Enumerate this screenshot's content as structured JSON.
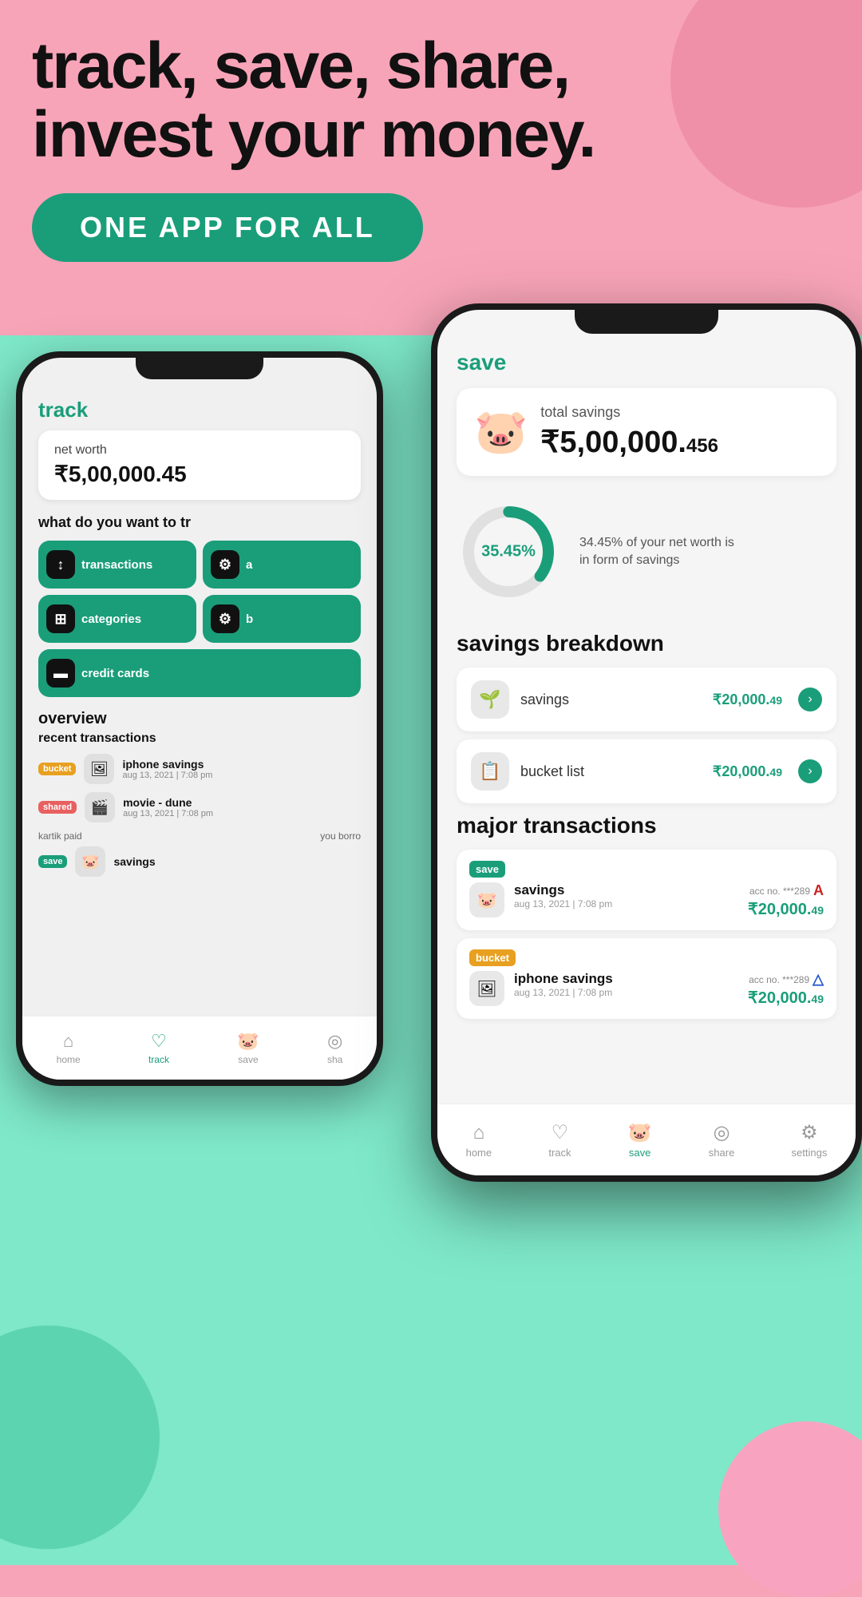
{
  "header": {
    "headline_line1": "track, save, share,",
    "headline_line2": "invest your money.",
    "cta": "ONE APP FOR ALL"
  },
  "track_screen": {
    "tab_label": "track",
    "net_worth_label": "net worth",
    "net_worth_value": "₹5,00,000.45",
    "question": "what do you want to tr",
    "buttons": [
      {
        "icon": "↕",
        "label": "transactions"
      },
      {
        "icon": "⚙",
        "label": "a"
      },
      {
        "icon": "⊞",
        "label": "categories"
      },
      {
        "icon": "⚙",
        "label": "b"
      },
      {
        "icon": "▬",
        "label": "credit cards"
      }
    ],
    "overview_label": "overview",
    "recent_label": "recent transactions",
    "transactions": [
      {
        "badge": "bucket",
        "icon": "🖼",
        "name": "iphone savings",
        "date": "aug 13, 2021 | 7:08 pm"
      },
      {
        "badge": "shared",
        "icon": "🎬",
        "name": "movie - dune",
        "date": "aug 13, 2021 | 7:08 pm"
      },
      {
        "badge": "save",
        "icon": "🐷",
        "name": "savings",
        "date": ""
      }
    ],
    "kartik_text": "kartik paid",
    "you_borro_text": "you borro",
    "nav": {
      "items": [
        {
          "label": "home",
          "active": false
        },
        {
          "label": "track",
          "active": true
        },
        {
          "label": "save",
          "active": false
        },
        {
          "label": "sha",
          "active": false
        }
      ]
    }
  },
  "save_screen": {
    "tab_label": "save",
    "total_savings_label": "total savings",
    "total_savings_value": "₹5,00,000.",
    "total_savings_decimal": "456",
    "donut_percent": "35.45%",
    "donut_description_line1": "34.45% of your net worth is",
    "donut_description_line2": "in form of savings",
    "savings_breakdown_title": "savings breakdown",
    "breakdown_items": [
      {
        "icon": "🌱",
        "name": "savings",
        "value": "₹20,000.",
        "decimal": "49"
      },
      {
        "icon": "📋",
        "name": "bucket list",
        "value": "₹20,000.",
        "decimal": "49"
      }
    ],
    "major_transactions_title": "major transactions",
    "major_transactions": [
      {
        "badge": "save",
        "icon": "🐷",
        "name": "savings",
        "date": "aug 13, 2021 | 7:08 pm",
        "acc_no": "acc no. ***289",
        "logo_type": "red",
        "logo_text": "A",
        "amount": "₹20,000.",
        "decimal": "49"
      },
      {
        "badge": "bucket",
        "icon": "🖼",
        "name": "iphone savings",
        "date": "aug 13, 2021 | 7:08 pm",
        "acc_no": "acc no. ***289",
        "logo_type": "blue",
        "logo_text": "△",
        "amount": "₹20,000.",
        "decimal": "49"
      }
    ],
    "nav": {
      "items": [
        {
          "label": "home",
          "active": false,
          "icon": "⌂"
        },
        {
          "label": "track",
          "active": false,
          "icon": "♡"
        },
        {
          "label": "save",
          "active": true,
          "icon": "🐷"
        },
        {
          "label": "share",
          "active": false,
          "icon": "◎"
        },
        {
          "label": "settings",
          "active": false,
          "icon": "⚙"
        }
      ]
    }
  }
}
